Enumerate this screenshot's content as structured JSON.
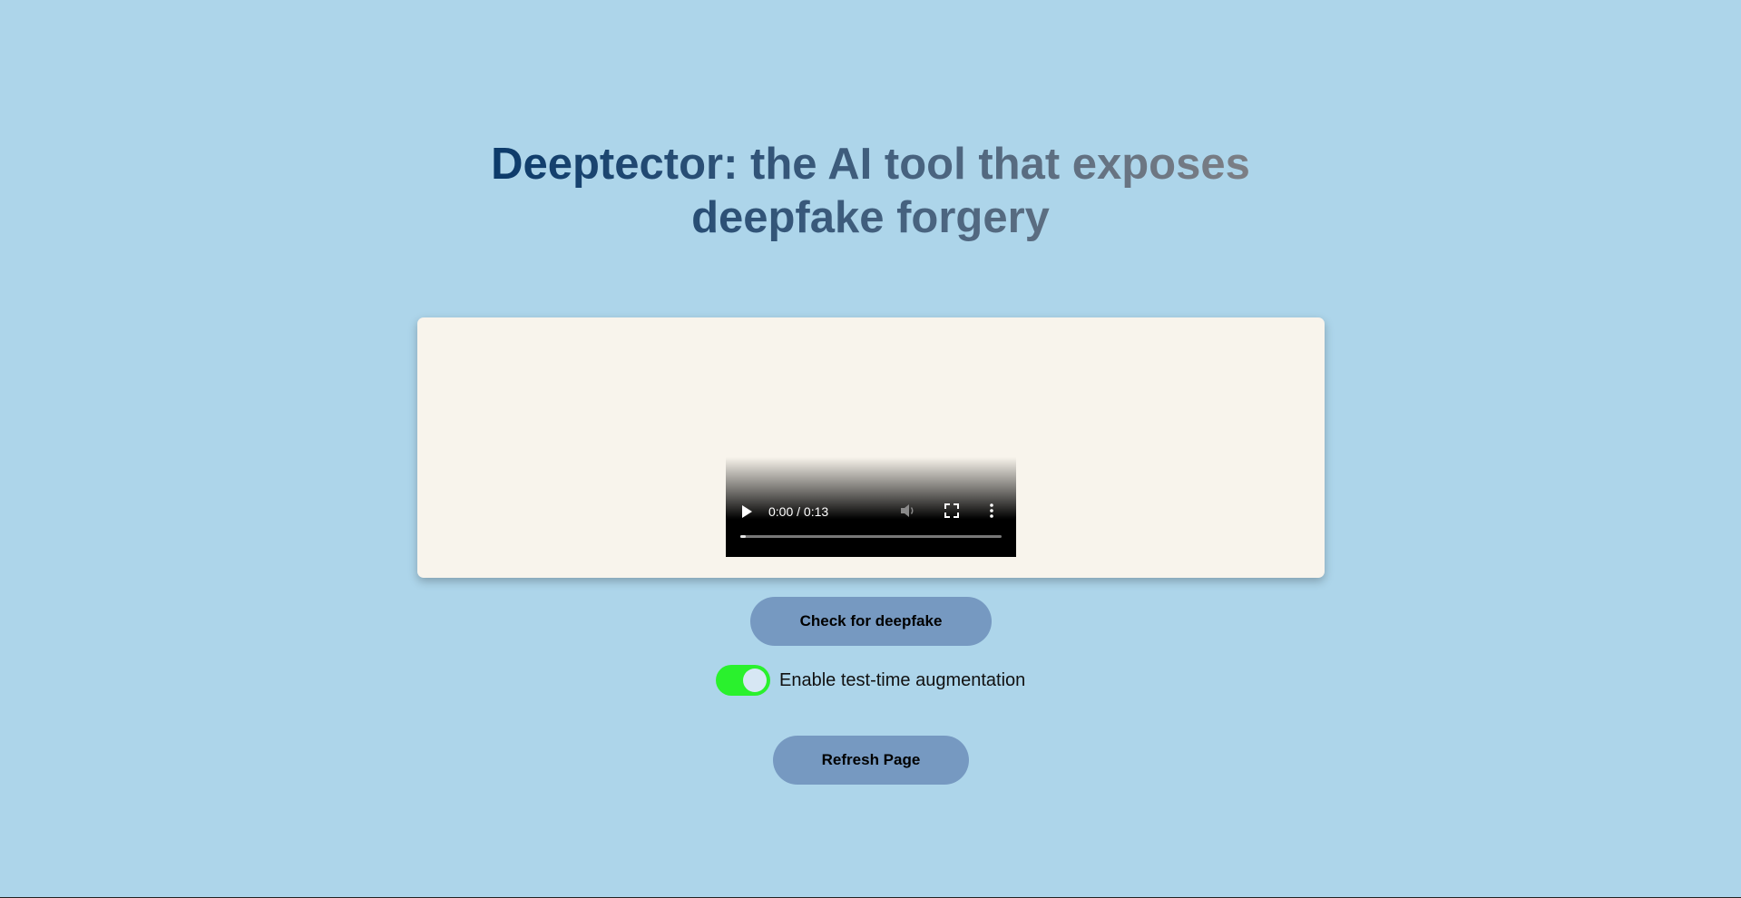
{
  "header": {
    "title_line1": "Deeptector: the AI tool that exposes",
    "title_line2": "deepfake forgery"
  },
  "video_player": {
    "time_display": "0:00 / 0:13",
    "progress": 0.02,
    "icons": [
      "play-icon",
      "mute-icon",
      "fullscreen-icon",
      "more-options-icon"
    ]
  },
  "actions": {
    "check_label": "Check for deepfake",
    "refresh_label": "Refresh Page"
  },
  "augmentation_toggle": {
    "label": "Enable test-time augmentation",
    "enabled": true
  },
  "colors": {
    "background": "#add5ea",
    "card": "#f8f4ec",
    "button": "#7699c1",
    "toggle_on": "#2af12d",
    "title_dark": "#0b3a6a",
    "title_gray": "#7d7f84"
  }
}
